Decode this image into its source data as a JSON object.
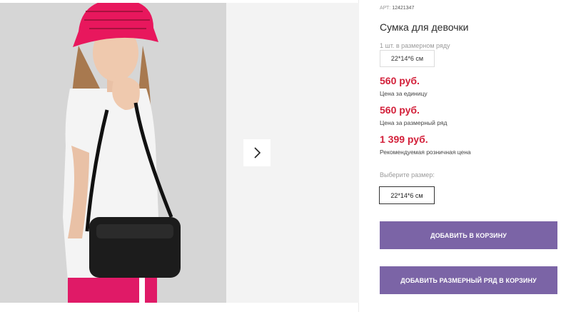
{
  "product": {
    "article_label": "АРТ:",
    "article_code": "12421347",
    "title": "Сумка для девочки",
    "set_caption": "1 шт. в размерном ряду",
    "set_size": "22*14*6 см"
  },
  "prices": [
    {
      "value": "560 руб.",
      "label": "Цена за единицу"
    },
    {
      "value": "560 руб.",
      "label": "Цена за размерный ряд"
    },
    {
      "value": "1 399 руб.",
      "label": "Рекомендуемая розничная цена"
    }
  ],
  "size_selector": {
    "label": "Выберите размер:",
    "options": [
      "22*14*6 см"
    ]
  },
  "buttons": {
    "add_to_cart": "Добавить в корзину",
    "add_set_to_cart": "Добавить размерный ряд в корзину"
  },
  "gallery": {
    "next_icon": "chevron-right-icon"
  },
  "colors": {
    "price": "#d3203a",
    "button": "#7b64a6",
    "hat": "#e8175d"
  }
}
